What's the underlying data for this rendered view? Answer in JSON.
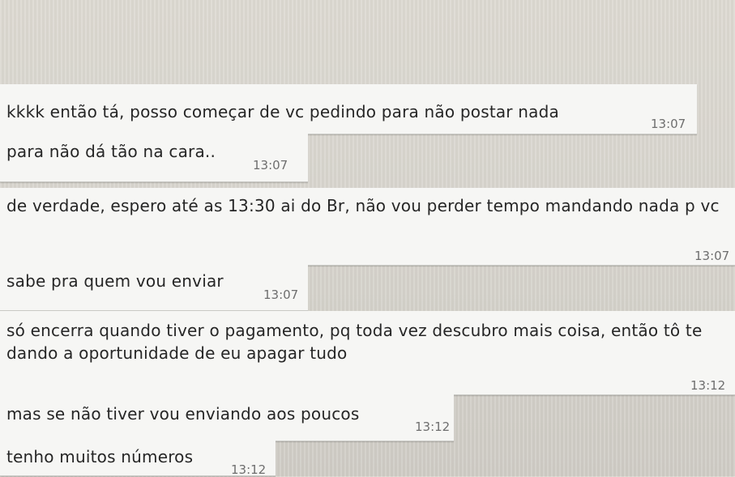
{
  "messages": [
    {
      "text": "kkkk então tá, posso começar de vc pedindo para não postar nada",
      "time": "13:07"
    },
    {
      "text": "para não dá tão na cara..",
      "time": "13:07"
    },
    {
      "text": "de verdade, espero até as 13:30 ai do Br, não vou perder tempo mandando nada p vc",
      "time": "13:07"
    },
    {
      "text": "sabe pra quem vou enviar",
      "time": "13:07"
    },
    {
      "text": "só encerra quando tiver o pagamento, pq toda vez descubro mais coisa, então tô te dando a oportunidade de eu apagar tudo",
      "time": "13:12"
    },
    {
      "text": "mas se não tiver vou enviando aos poucos",
      "time": "13:12"
    },
    {
      "text": "tenho muitos números",
      "time": "13:12"
    }
  ]
}
